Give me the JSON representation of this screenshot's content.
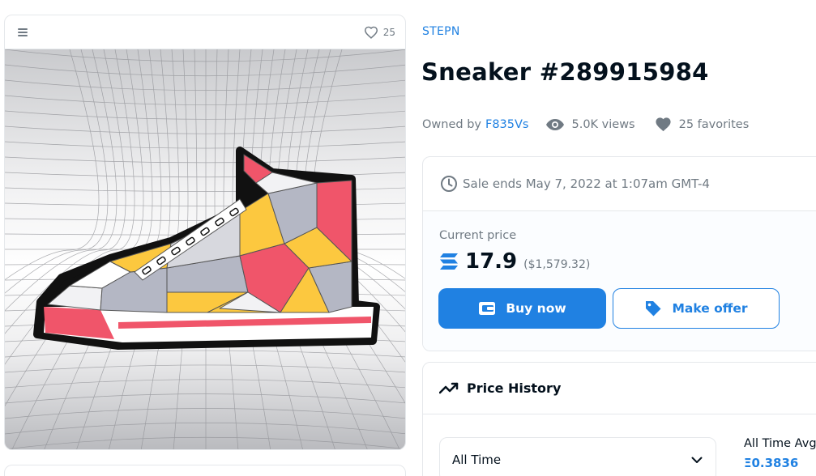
{
  "media": {
    "favorites_count": "25",
    "image_alt": "Sneaker #289915984"
  },
  "collection": {
    "name": "STEPN"
  },
  "asset": {
    "title": "Sneaker #289915984",
    "owned_by_label": "Owned by",
    "owner": "F835Vs",
    "views": "5.0K views",
    "favorites": "25 favorites"
  },
  "sale": {
    "ends_text": "Sale ends May 7, 2022 at 1:07am GMT-4",
    "current_price_label": "Current price",
    "price": "17.9",
    "price_fiat": "($1,579.32)",
    "currency_icon": "sol-icon",
    "buy_label": "Buy now",
    "offer_label": "Make offer"
  },
  "price_history": {
    "title": "Price History",
    "range_selected": "All Time",
    "avg_label": "All Time Avg",
    "avg_value": "Ξ0.3836"
  },
  "colors": {
    "accent": "#2081e2",
    "text_primary": "#04111d",
    "text_secondary": "#707a83",
    "border": "#e5e8eb",
    "sneaker_red": "#f0556a",
    "sneaker_yellow": "#fcc83f",
    "sneaker_gray": "#b4b7c4"
  }
}
